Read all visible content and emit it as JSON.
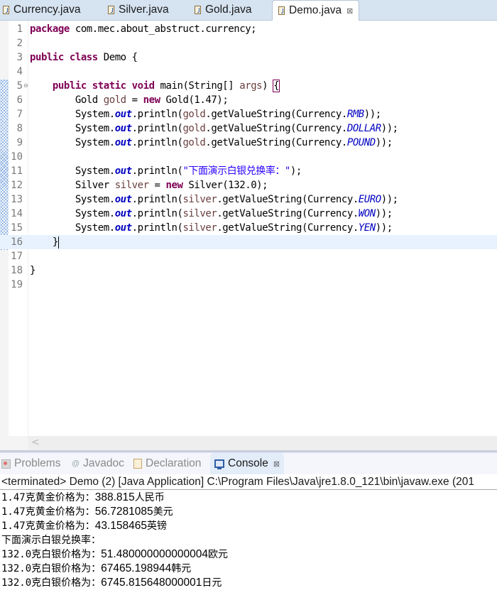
{
  "editor_tabs": [
    {
      "label": "Currency.java",
      "active": false,
      "icon": "java-file-icon"
    },
    {
      "label": "Silver.java",
      "active": false,
      "icon": "java-file-icon"
    },
    {
      "label": "Gold.java",
      "active": false,
      "icon": "java-file-icon"
    },
    {
      "label": "Demo.java",
      "active": true,
      "icon": "java-file-icon",
      "close": "⊠"
    }
  ],
  "code": {
    "l1": {
      "kw": "package",
      "rest": " com.mec.about_abstruct.currency;"
    },
    "l3": {
      "kw1": "public",
      "kw2": "class",
      "rest": " Demo {"
    },
    "l5": {
      "indent": "    ",
      "kw1": "public",
      "kw2": "static",
      "kw3": "void",
      "mid": " main(String[] ",
      "param": "args",
      "close": ") ",
      "brace": "{"
    },
    "l6": {
      "indent": "        ",
      "type": "Gold ",
      "var": "gold",
      "eq": " = ",
      "kw": "new",
      "rest": " Gold(1.47);"
    },
    "l7": {
      "indent": "        ",
      "sys": "System.",
      "out": "out",
      "mid": ".println(",
      "var": "gold",
      "call": ".getValueString(Currency.",
      "enum": "RMB",
      "end": "));"
    },
    "l8": {
      "indent": "        ",
      "sys": "System.",
      "out": "out",
      "mid": ".println(",
      "var": "gold",
      "call": ".getValueString(Currency.",
      "enum": "DOLLAR",
      "end": "));"
    },
    "l9": {
      "indent": "        ",
      "sys": "System.",
      "out": "out",
      "mid": ".println(",
      "var": "gold",
      "call": ".getValueString(Currency.",
      "enum": "POUND",
      "end": "));"
    },
    "l11": {
      "indent": "        ",
      "sys": "System.",
      "out": "out",
      "mid": ".println(",
      "str": "\"下面演示白银兑换率：\"",
      "end": ");"
    },
    "l12": {
      "indent": "        ",
      "type": "Silver ",
      "var": "silver",
      "eq": " = ",
      "kw": "new",
      "rest": " Silver(132.0);"
    },
    "l13": {
      "indent": "        ",
      "sys": "System.",
      "out": "out",
      "mid": ".println(",
      "var": "silver",
      "call": ".getValueString(Currency.",
      "enum": "EURO",
      "end": "));"
    },
    "l14": {
      "indent": "        ",
      "sys": "System.",
      "out": "out",
      "mid": ".println(",
      "var": "silver",
      "call": ".getValueString(Currency.",
      "enum": "WON",
      "end": "));"
    },
    "l15": {
      "indent": "        ",
      "sys": "System.",
      "out": "out",
      "mid": ".println(",
      "var": "silver",
      "call": ".getValueString(Currency.",
      "enum": "YEN",
      "end": "));"
    },
    "l16": {
      "indent": "    ",
      "rest": "}"
    },
    "l18": {
      "rest": "}"
    }
  },
  "line_numbers": [
    "1",
    "2",
    "3",
    "4",
    "5",
    "6",
    "7",
    "8",
    "9",
    "10",
    "11",
    "12",
    "13",
    "14",
    "15",
    "16",
    "17",
    "18",
    "19"
  ],
  "fold_marker": "⊖",
  "scroll_arrow": "<",
  "panel_tabs": [
    {
      "label": "Problems",
      "active": false
    },
    {
      "label": "Javadoc",
      "active": false
    },
    {
      "label": "Declaration",
      "active": false
    },
    {
      "label": "Console",
      "active": true,
      "close": "⊠"
    }
  ],
  "console": {
    "header": "<terminated> Demo (2) [Java Application] C:\\Program Files\\Java\\jre1.8.0_121\\bin\\javaw.exe (201",
    "lines": [
      {
        "prefix": "1.47克黄金价格为：",
        "value": "388.815",
        "unit": "人民币"
      },
      {
        "prefix": "1.47克黄金价格为：",
        "value": "56.7281085",
        "unit": "美元"
      },
      {
        "prefix": "1.47克黄金价格为：",
        "value": "43.158465",
        "unit": "英镑"
      },
      {
        "prefix": "下面演示白银兑换率：",
        "value": "",
        "unit": ""
      },
      {
        "prefix": "132.0克白银价格为：",
        "value": "51.480000000000004",
        "unit": "欧元"
      },
      {
        "prefix": "132.0克白银价格为：",
        "value": "67465.198944",
        "unit": "韩元"
      },
      {
        "prefix": "132.0克白银价格为：",
        "value": "6745.815648000001",
        "unit": "日元"
      }
    ]
  },
  "colors": {
    "keyword": "#7f0055",
    "field": "#0000c0",
    "string": "#2a00ff",
    "local_var": "#6a3e3e",
    "current_line": "#e8f2fe"
  }
}
